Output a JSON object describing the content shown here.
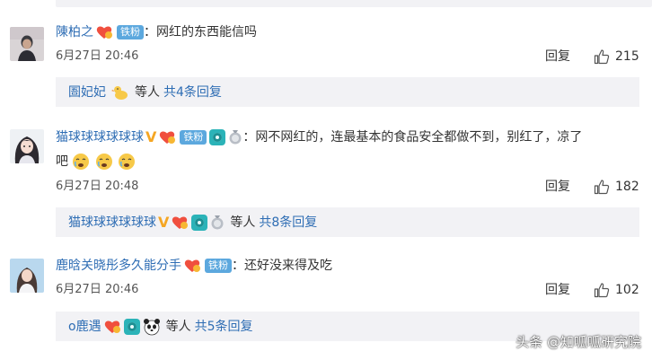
{
  "comments": [
    {
      "username": "陳柏之",
      "fan_badge": "铁粉",
      "text": "：网红的东西能信吗",
      "time": "6月27日 20:46",
      "reply_label": "回复",
      "likes": "215",
      "sub": {
        "user": "圄妃妃",
        "middle": "等人",
        "more": "共4条回复"
      }
    },
    {
      "username": "猫球球球球球球",
      "fan_badge": "铁粉",
      "text": "：网不网红的，连最基本的食品安全都做不到，别红了，凉了",
      "text_cont": "吧",
      "time": "6月27日 20:48",
      "reply_label": "回复",
      "likes": "182",
      "sub": {
        "user": "猫球球球球球球",
        "middle": "等人",
        "more": "共8条回复"
      }
    },
    {
      "username": "鹿晗关晓彤多久能分手",
      "fan_badge": "铁粉",
      "text": "：还好没来得及吃",
      "time": "6月27日 20:46",
      "reply_label": "回复",
      "likes": "102",
      "sub": {
        "user": "o鹿遇",
        "middle": "等人",
        "more": "共5条回复"
      }
    }
  ],
  "watermark": "头条 @知呱呱研究院",
  "colors": {
    "link": "#2e6db4",
    "fan_badge": "#5ca8de",
    "sub_bg": "#f2f2f5"
  }
}
